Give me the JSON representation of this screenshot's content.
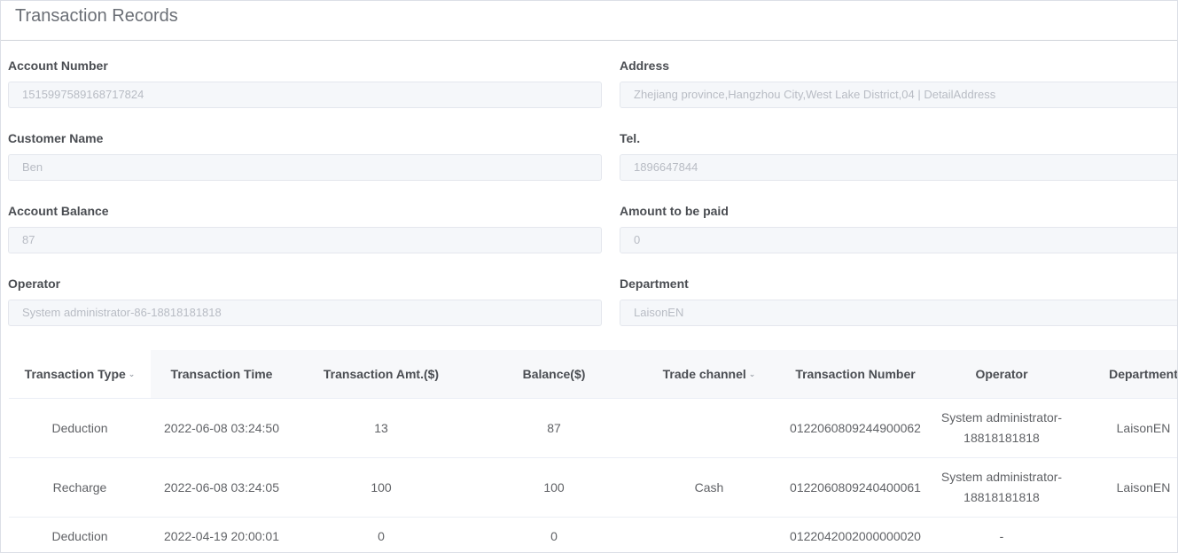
{
  "header": {
    "title": "Transaction Records"
  },
  "form": {
    "account_number": {
      "label": "Account Number",
      "value": "1515997589168717824"
    },
    "address": {
      "label": "Address",
      "value": "Zhejiang province,Hangzhou City,West Lake District,04 | DetailAddress"
    },
    "customer_name": {
      "label": "Customer Name",
      "value": "Ben"
    },
    "tel": {
      "label": "Tel.",
      "value": "1896647844"
    },
    "account_balance": {
      "label": "Account Balance",
      "value": "87"
    },
    "amount_to_be_paid": {
      "label": "Amount to be paid",
      "value": "0"
    },
    "operator": {
      "label": "Operator",
      "value": "System administrator-86-18818181818"
    },
    "department": {
      "label": "Department",
      "value": "LaisonEN"
    }
  },
  "table": {
    "columns": {
      "type": "Transaction Type",
      "time": "Transaction Time",
      "amount": "Transaction Amt.($)",
      "balance": "Balance($)",
      "channel": "Trade channel",
      "number": "Transaction Number",
      "operator": "Operator",
      "department": "Department"
    },
    "rows": [
      {
        "type": "Deduction",
        "time": "2022-06-08 03:24:50",
        "amount": "13",
        "balance": "87",
        "channel": "",
        "number": "0122060809244900062",
        "operator_line1": "System administrator-",
        "operator_line2": "18818181818",
        "department": "LaisonEN"
      },
      {
        "type": "Recharge",
        "time": "2022-06-08 03:24:05",
        "amount": "100",
        "balance": "100",
        "channel": "Cash",
        "number": "0122060809240400061",
        "operator_line1": "System administrator-",
        "operator_line2": "18818181818",
        "department": "LaisonEN"
      },
      {
        "type": "Deduction",
        "time": "2022-04-19 20:00:01",
        "amount": "0",
        "balance": "0",
        "channel": "",
        "number": "0122042002000000020",
        "operator_line1": "-",
        "operator_line2": "",
        "department": ""
      }
    ]
  },
  "icons": {
    "filter_chevron": "chevron-down-icon",
    "filter_glyph": "⌄"
  }
}
